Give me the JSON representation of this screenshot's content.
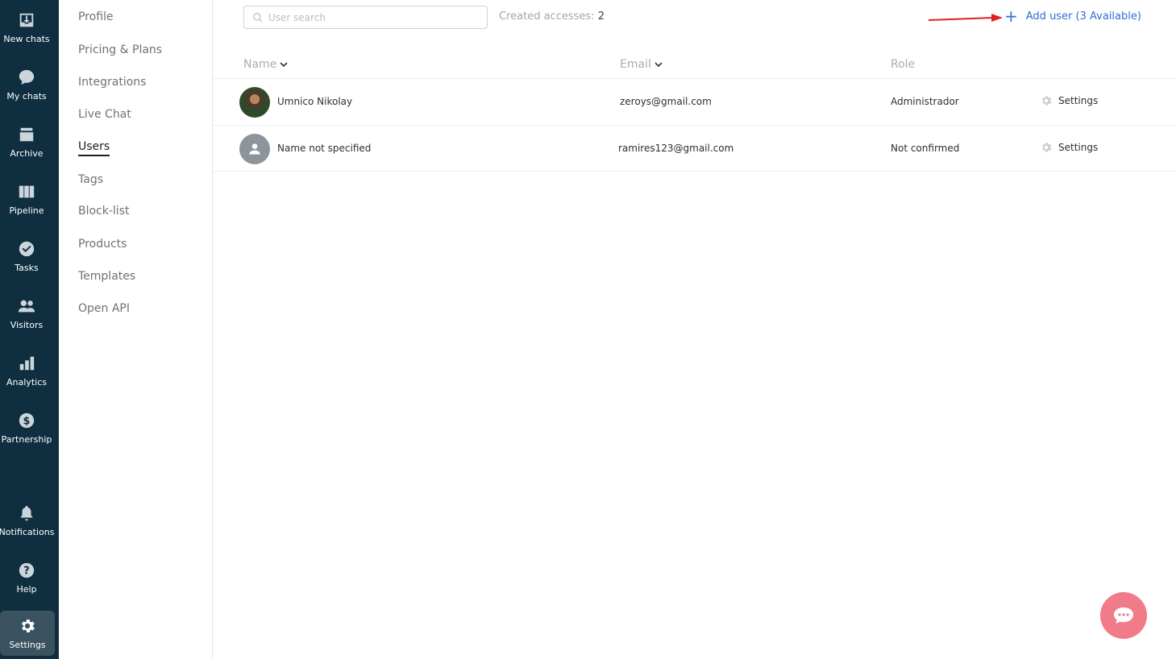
{
  "rail": {
    "items": [
      {
        "label": "New chats",
        "icon": "inbox-download-icon"
      },
      {
        "label": "My chats",
        "icon": "chat-bubble-icon"
      },
      {
        "label": "Archive",
        "icon": "archive-box-icon"
      },
      {
        "label": "Pipeline",
        "icon": "pipeline-columns-icon"
      },
      {
        "label": "Tasks",
        "icon": "check-circle-icon"
      },
      {
        "label": "Visitors",
        "icon": "people-icon"
      },
      {
        "label": "Analytics",
        "icon": "bar-chart-icon"
      },
      {
        "label": "Partnership",
        "icon": "dollar-coin-icon"
      },
      {
        "label": "Notifications",
        "icon": "bell-icon"
      },
      {
        "label": "Help",
        "icon": "question-circle-icon"
      },
      {
        "label": "Settings",
        "icon": "gear-icon"
      }
    ]
  },
  "nav": {
    "items": [
      {
        "label": "Profile"
      },
      {
        "label": "Pricing & Plans"
      },
      {
        "label": "Integrations"
      },
      {
        "label": "Live Chat"
      },
      {
        "label": "Users"
      },
      {
        "label": "Tags"
      },
      {
        "label": "Block-list"
      },
      {
        "label": "Products"
      },
      {
        "label": "Templates"
      },
      {
        "label": "Open API"
      }
    ]
  },
  "toolbar": {
    "search_placeholder": "User search",
    "created_label": "Created accesses:",
    "created_count": "2",
    "add_user_label": "Add user (3 Available)"
  },
  "table": {
    "headers": {
      "name": "Name",
      "email": "Email",
      "role": "Role"
    },
    "rows": [
      {
        "name": "Umnico Nikolay",
        "email": "zeroys@gmail.com",
        "role": "Administrador",
        "settings": "Settings"
      },
      {
        "name": "Name not specified",
        "email": "ramires123@gmail.com",
        "role": "Not confirmed",
        "settings": "Settings"
      }
    ]
  },
  "colors": {
    "rail_bg": "#0f2f40",
    "accent_link": "#2d6fd8",
    "chat_bubble": "#f27b8a",
    "annotation_arrow": "#e02020"
  }
}
